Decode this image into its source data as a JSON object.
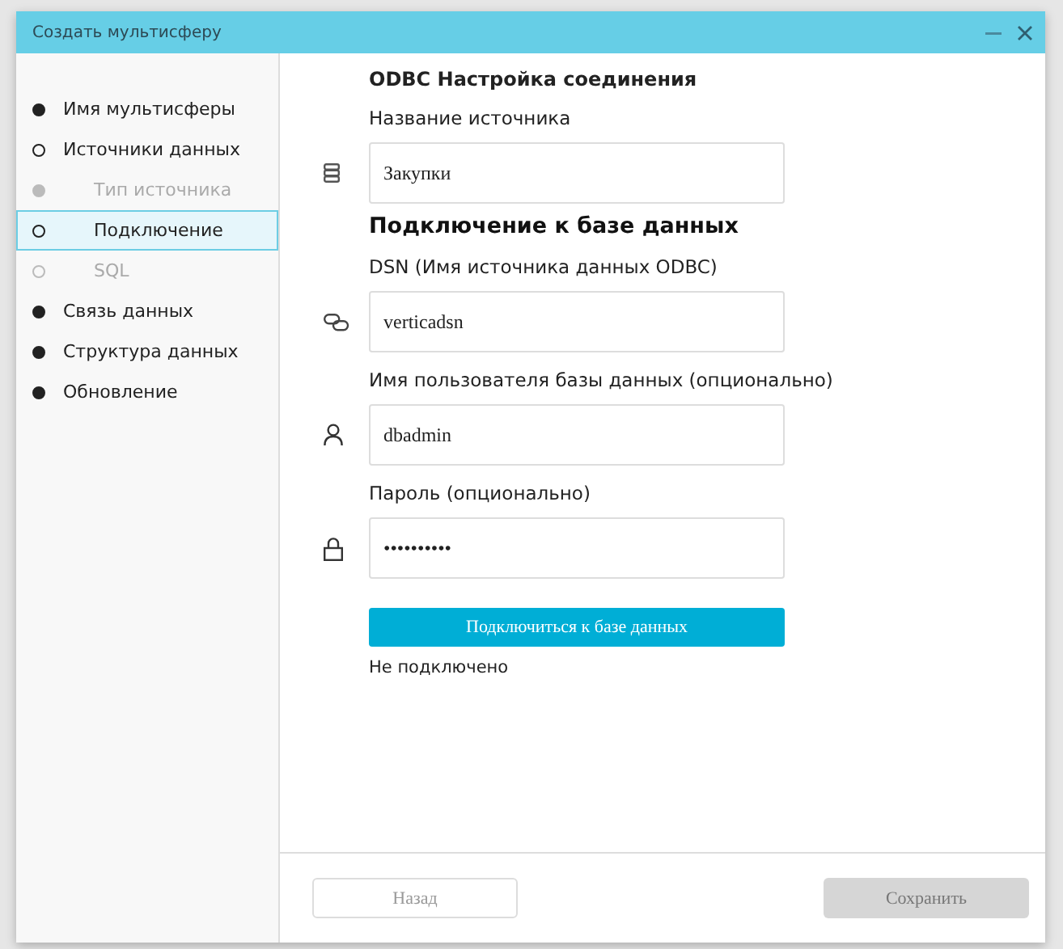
{
  "window": {
    "title": "Создать мультисферу"
  },
  "steps": [
    {
      "label": "Имя мультисферы",
      "filled": true,
      "disabled": false,
      "selected": false
    },
    {
      "label": "Источники данных",
      "filled": false,
      "disabled": false,
      "selected": false,
      "children": [
        {
          "label": "Тип источника",
          "filled": true,
          "disabled": true,
          "selected": false
        },
        {
          "label": "Подключение",
          "filled": false,
          "disabled": false,
          "selected": true
        },
        {
          "label": "SQL",
          "filled": false,
          "disabled": true,
          "selected": false
        }
      ]
    },
    {
      "label": "Связь данных",
      "filled": true,
      "disabled": false,
      "selected": false
    },
    {
      "label": "Структура данных",
      "filled": true,
      "disabled": false,
      "selected": false
    },
    {
      "label": "Обновление",
      "filled": true,
      "disabled": false,
      "selected": false
    }
  ],
  "form": {
    "title": "ODBC Настройка соединения",
    "sections": [
      {
        "fields": [
          {
            "label": "Название источника",
            "value": "Закупки"
          }
        ]
      },
      {
        "heading": "Подключение к базе данных",
        "fields": [
          {
            "label": "DSN (Имя источника данных ODBC)",
            "value": "verticadsn"
          },
          {
            "label": "Имя пользователя базы данных (опционально)",
            "value": "dbadmin"
          },
          {
            "label": "Пароль (опционально)",
            "value": "••••••••••"
          }
        ]
      }
    ],
    "connect_button": {
      "label": "Подключиться к базе данных",
      "disabled": false
    },
    "status": "Не подключено"
  },
  "footer": {
    "back": {
      "label": "Назад",
      "disabled": true
    },
    "save": {
      "label": "Сохранить",
      "disabled": true
    }
  }
}
